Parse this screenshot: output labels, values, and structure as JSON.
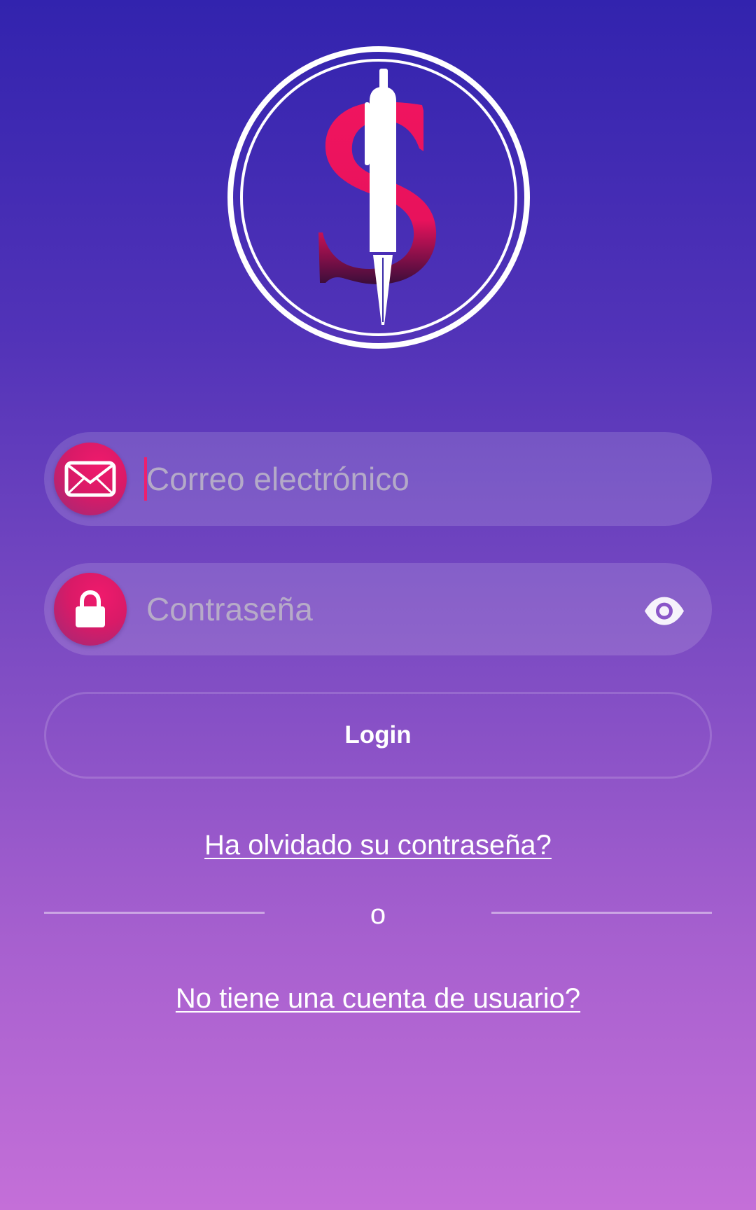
{
  "logo": {
    "icon": "dollar-pen-logo",
    "colors": {
      "ring": "#ffffff",
      "letter": "#f0145f",
      "pen": "#ffffff"
    }
  },
  "login_form": {
    "email": {
      "icon": "envelope-icon",
      "placeholder": "Correo electrónico",
      "value": ""
    },
    "password": {
      "icon": "lock-icon",
      "placeholder": "Contraseña",
      "value": "",
      "toggle_icon": "eye-icon"
    },
    "login_label": "Login"
  },
  "links": {
    "forgot_password": "Ha olvidado su contraseña?",
    "separator": "o",
    "register": "No tiene una cuenta de usuario?"
  },
  "theme": {
    "gradient_top": "#3223ae",
    "gradient_bottom": "#c46fd8",
    "accent": "#ee1f6e"
  }
}
